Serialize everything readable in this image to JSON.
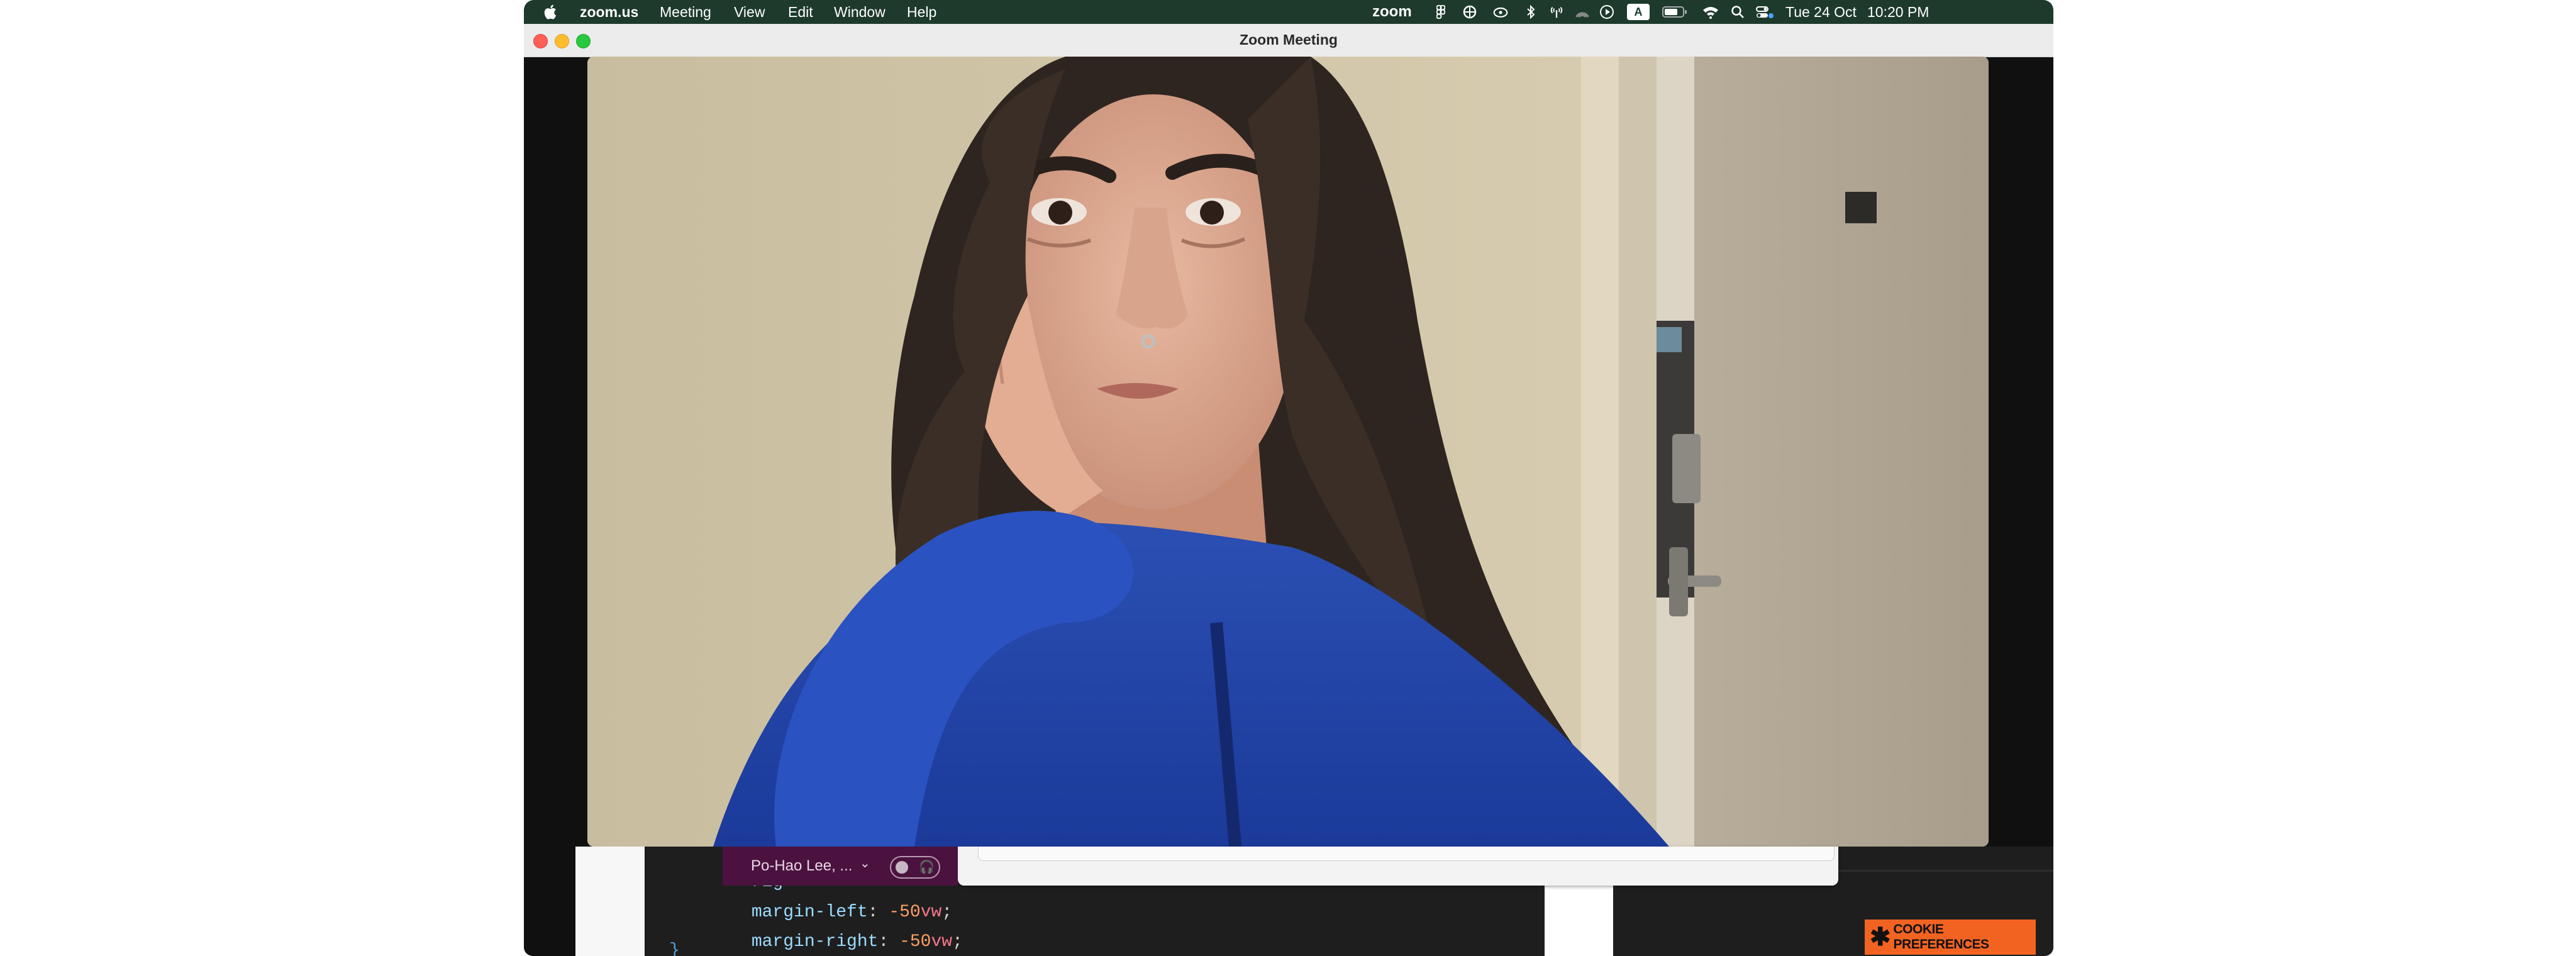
{
  "menubar": {
    "apple_icon": "apple-icon",
    "app_name": "zoom.us",
    "menus": [
      "Meeting",
      "View",
      "Edit",
      "Window",
      "Help"
    ],
    "status": {
      "zoom_label": "zoom",
      "input_source": "A",
      "date": "Tue 24 Oct",
      "time": "10:20 PM"
    },
    "background_color": "#1d3a2d"
  },
  "window": {
    "title": "Zoom Meeting"
  },
  "participant": {
    "name": "Po-Hao Lee, ..."
  },
  "shared_screen": {
    "code_lines": [
      {
        "prop": "rig",
        "value": ""
      },
      {
        "prop": "margin-left",
        "num": "-50",
        "unit": "vw"
      },
      {
        "prop": "margin-right",
        "num": "-50",
        "unit": "vw"
      }
    ],
    "closing_brace": "}",
    "cookie_button": "COOKIE PREFERENCES"
  },
  "colors": {
    "cookie": "#f26322",
    "chip": "#4b123f",
    "code_bg": "#1e1e1e"
  }
}
